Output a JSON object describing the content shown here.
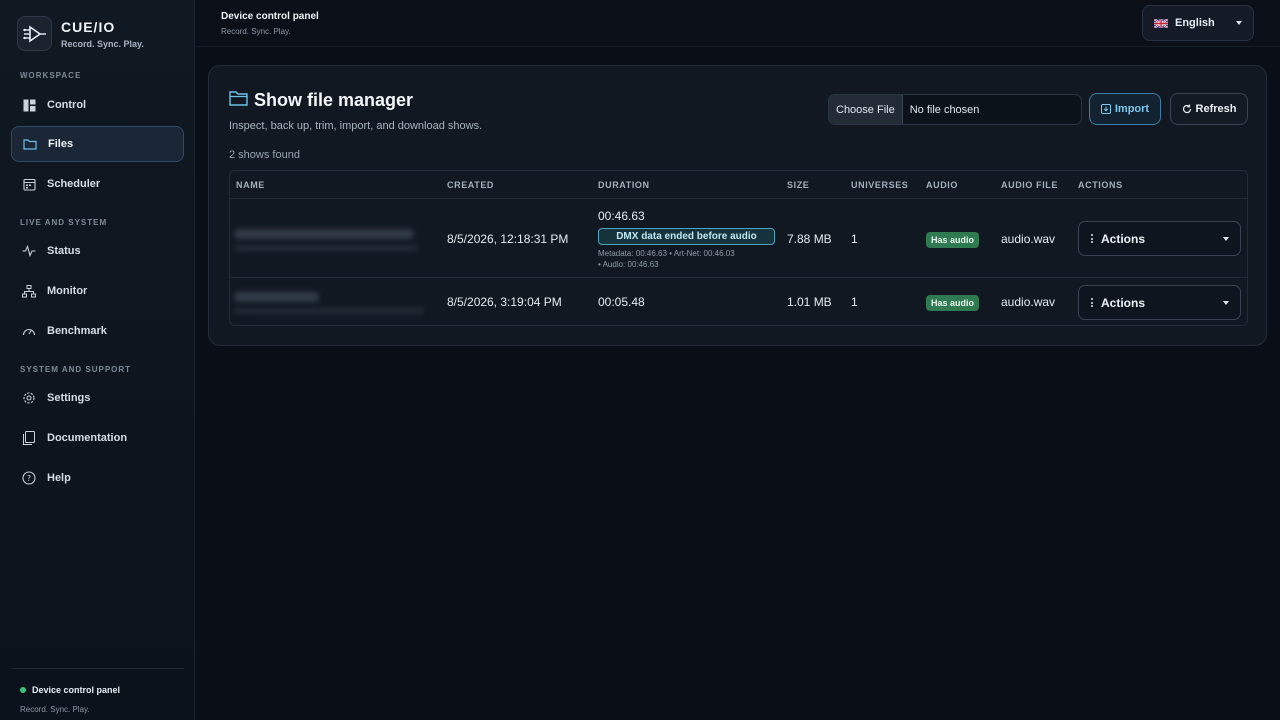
{
  "brand": {
    "name": "CUE/IO",
    "tagline": "Record. Sync. Play."
  },
  "sidebar": {
    "sections": [
      {
        "label": "WORKSPACE"
      },
      {
        "label": "LIVE AND SYSTEM"
      },
      {
        "label": "SYSTEM AND SUPPORT"
      }
    ],
    "items": [
      {
        "label": "Control",
        "icon": "dashboard-icon"
      },
      {
        "label": "Files",
        "icon": "folder-icon",
        "active": true
      },
      {
        "label": "Scheduler",
        "icon": "calendar-icon"
      },
      {
        "label": "Status",
        "icon": "activity-icon"
      },
      {
        "label": "Monitor",
        "icon": "network-icon"
      },
      {
        "label": "Benchmark",
        "icon": "gauge-icon"
      },
      {
        "label": "Settings",
        "icon": "gear-icon"
      },
      {
        "label": "Documentation",
        "icon": "document-icon"
      },
      {
        "label": "Help",
        "icon": "help-icon"
      }
    ],
    "footer": {
      "title": "Device control panel",
      "subtitle": "Record. Sync. Play."
    }
  },
  "header": {
    "title": "Device control panel",
    "subtitle": "Record. Sync. Play.",
    "language": "English"
  },
  "main": {
    "title": "Show file manager",
    "subtitle": "Inspect, back up, trim, import, and download shows.",
    "count_label": "2 shows found",
    "file_input": {
      "button": "Choose File",
      "status": "No file chosen"
    },
    "import_label": "Import",
    "refresh_label": "Refresh",
    "table": {
      "columns": [
        "NAME",
        "CREATED",
        "DURATION",
        "SIZE",
        "UNIVERSES",
        "AUDIO",
        "AUDIO FILE",
        "ACTIONS"
      ],
      "rows": [
        {
          "created": "8/5/2026, 12:18:31 PM",
          "duration": "00:46.63",
          "warning": "DMX data ended before audio",
          "meta_line1": "Metadata: 00:46.63 • Art-Net: 00:46.03",
          "meta_line2": "• Audio: 00:46.63",
          "size": "7.88 MB",
          "universes": "1",
          "audio": "Has audio",
          "audio_file": "audio.wav",
          "actions": "Actions"
        },
        {
          "created": "8/5/2026, 3:19:04 PM",
          "duration": "00:05.48",
          "size": "1.01 MB",
          "universes": "1",
          "audio": "Has audio",
          "audio_file": "audio.wav",
          "actions": "Actions"
        }
      ]
    }
  },
  "colors": {
    "accent": "#4fb3e0",
    "success": "#2f7a50",
    "status_dot": "#3bc27a"
  }
}
